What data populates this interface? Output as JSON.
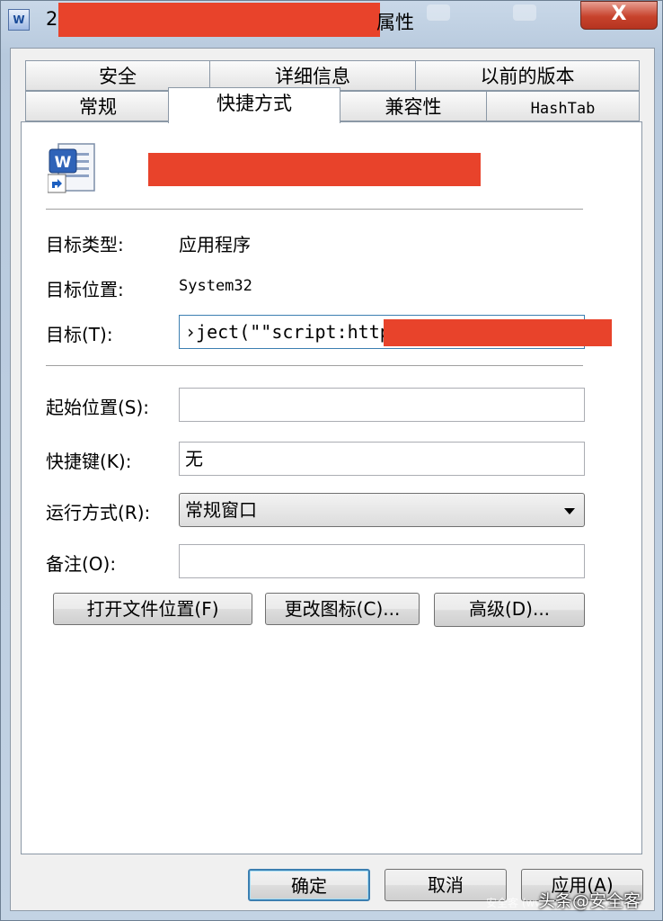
{
  "window": {
    "title_prefix": "2(",
    "title_suffix": "属性",
    "close_label": "X",
    "icon": "word-document-icon"
  },
  "tabs_row1": [
    {
      "label": "安全"
    },
    {
      "label": "详细信息"
    },
    {
      "label": "以前的版本"
    }
  ],
  "tabs_row2": [
    {
      "label": "常规"
    },
    {
      "label": "快捷方式",
      "active": true
    },
    {
      "label": "兼容性"
    },
    {
      "label": "HashTab"
    }
  ],
  "fields": {
    "target_type": {
      "label": "目标类型:",
      "value": "应用程序"
    },
    "target_location": {
      "label": "目标位置:",
      "value": "System32"
    },
    "target": {
      "label": "目标(T):",
      "value": "›ject(\"\"script:https"
    },
    "start_in": {
      "label": "起始位置(S):",
      "value": ""
    },
    "shortcut_key": {
      "label": "快捷键(K):",
      "value": "无"
    },
    "run": {
      "label": "运行方式(R):",
      "value": "常规窗口"
    },
    "comment": {
      "label": "备注(O):",
      "value": ""
    }
  },
  "buttons": {
    "open_location": "打开文件位置(F)",
    "change_icon": "更改图标(C)...",
    "advanced": "高级(D)...",
    "ok": "确定",
    "cancel": "取消",
    "apply": "应用(A)"
  },
  "watermark": {
    "main": "头条@安全客",
    "faint": "安全客 (www.anquanke.com)"
  },
  "colors": {
    "redaction": "#e8432b",
    "focus_border": "#3c7fb1"
  }
}
